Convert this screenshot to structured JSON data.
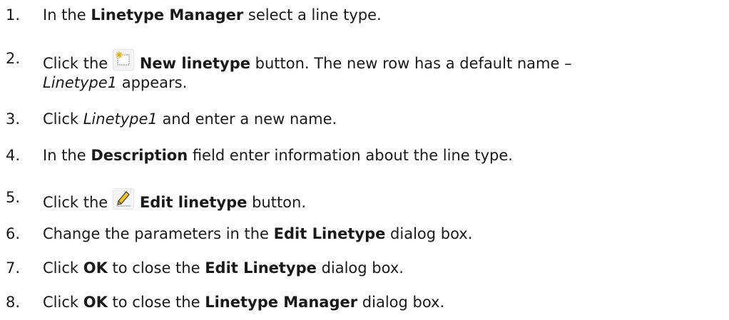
{
  "steps": [
    {
      "number": "1.",
      "t1": "In the ",
      "b1": "Linetype Manager",
      "t2": " select a line type."
    },
    {
      "number": "2.",
      "t1": "Click the ",
      "icon": "new-linetype-icon",
      "b1": "New linetype",
      "t2": " button. The new row has a default name –",
      "i1": "Linetype1",
      "t3": " appears."
    },
    {
      "number": "3.",
      "t1": "Click ",
      "i1": "Linetype1",
      "t2": " and enter a new name."
    },
    {
      "number": "4.",
      "t1": "In the ",
      "b1": "Description",
      "t2": " field enter information about the line type."
    },
    {
      "number": "5.",
      "t1": "Click the ",
      "icon": "edit-linetype-icon",
      "b1": "Edit linetype",
      "t2": " button."
    },
    {
      "number": "6.",
      "t1": "Change the parameters in the ",
      "b1": "Edit Linetype",
      "t2": " dialog box."
    },
    {
      "number": "7.",
      "t1": "Click ",
      "b1": "OK",
      "t2": " to close the ",
      "b2": "Edit Linetype",
      "t3": " dialog box."
    },
    {
      "number": "8.",
      "t1": "Click ",
      "b1": "OK",
      "t2": " to close the ",
      "b2": "Linetype Manager",
      "t3": " dialog box."
    }
  ]
}
